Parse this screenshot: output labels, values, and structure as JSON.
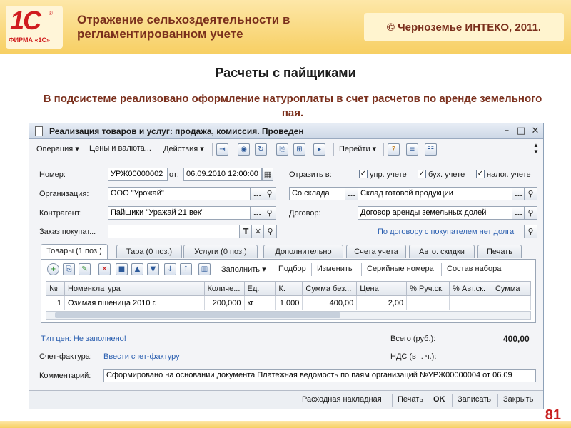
{
  "slide": {
    "logo_mark": "1С",
    "logo_caption": "ФИРМА «1С»",
    "title": "Отражение сельхоздеятельности в регламентированном учете",
    "copyright": "© Черноземье ИНТЕКО, 2011.",
    "heading": "Расчеты с пайщиками",
    "description": "В подсистеме реализовано оформление натуроплаты в счет расчетов по аренде земельного пая.",
    "page_number": "81"
  },
  "colors": {
    "brand_red": "#d01c1f",
    "header_band": "#f7cf63",
    "text_brown": "#7a2f1c",
    "link_blue": "#2b5fb0"
  },
  "window": {
    "title": "Реализация товаров и услуг: продажа, комиссия. Проведен",
    "toolbar": {
      "operation": "Операция",
      "prices": "Цены и валюта...",
      "actions": "Действия",
      "goto": "Перейти"
    },
    "form": {
      "number_label": "Номер:",
      "number_value": "УРЖ00000002",
      "date_label": "от:",
      "date_value": "06.09.2010 12:00:00",
      "reflect_label": "Отразить в:",
      "check_mgmt": "упр. учете",
      "check_acc": "бух. учете",
      "check_tax": "налог. учете",
      "org_label": "Организация:",
      "org_value": "ООО \"Урожай\"",
      "ship_value": "Со склада",
      "warehouse_value": "Склад готовой продукции",
      "contractor_label": "Контрагент:",
      "contractor_value": "Пайщики \"Уражай 21 век\"",
      "contract_label": "Договор:",
      "contract_value": "Договор аренды земельных долей",
      "order_label": "Заказ покупат...",
      "order_value": "",
      "order_link": "По договору с покупателем нет долга"
    },
    "tabs": [
      "Товары (1 поз.)",
      "Тара (0 поз.)",
      "Услуги (0 поз.)",
      "Дополнительно",
      "Счета учета",
      "Авто. скидки",
      "Печать"
    ],
    "table_toolbar": {
      "fill": "Заполнить",
      "select": "Подбор",
      "change": "Изменить",
      "serials": "Серийные номера",
      "kit": "Состав набора"
    },
    "table": {
      "headers": [
        "№",
        "Номенклатура",
        "Количе...",
        "Ед.",
        "К.",
        "Сумма без...",
        "Цена",
        "% Руч.ск.",
        "% Авт.ск.",
        "Сумма"
      ],
      "rows": [
        [
          "1",
          "Озимая пшеница 2010 г.",
          "200,000",
          "кг",
          "1,000",
          "400,00",
          "2,00",
          "",
          "",
          ""
        ]
      ]
    },
    "footer": {
      "price_type": "Тип цен: Не заполнено!",
      "total_label": "Всего (руб.):",
      "total_value": "400,00",
      "invoice_label": "Счет-фактура:",
      "invoice_link": "Ввести счет-фактуру",
      "vat_label": "НДС (в т. ч.):",
      "vat_value": "",
      "comment_label": "Комментарий:",
      "comment_value": "Сформировано на основании документа Платежная ведомость по паям организаций №УРЖ00000004 от 06.09"
    },
    "bottom_buttons": {
      "waybill": "Расходная накладная",
      "print": "Печать",
      "ok": "OK",
      "save": "Записать",
      "close": "Закрыть"
    }
  }
}
